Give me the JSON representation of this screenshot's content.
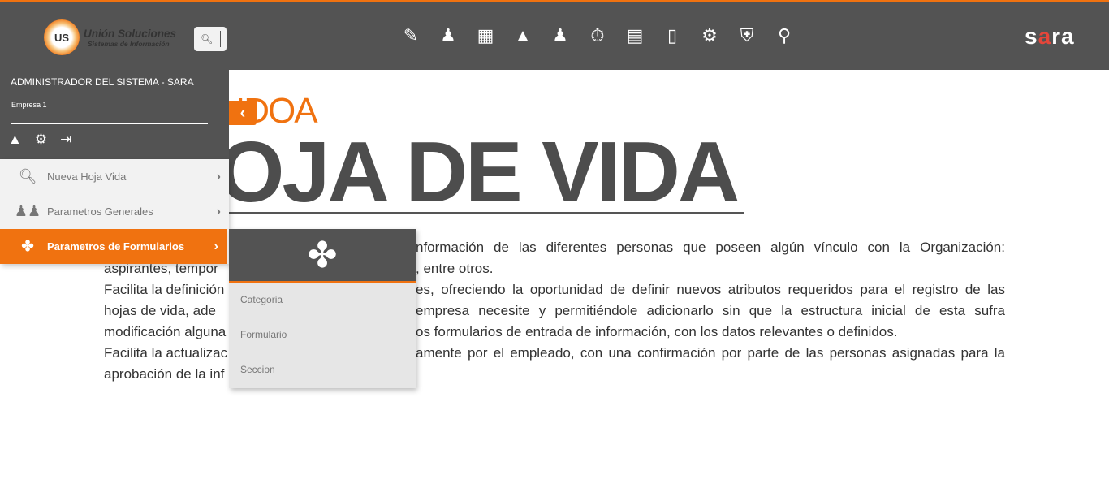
{
  "header": {
    "logo_title": "Unión Soluciones",
    "logo_subtitle": "Sistemas de Información",
    "logo_badge": "US",
    "search_icon": "search-icon",
    "nav_icons": [
      "form-edit-icon",
      "employee-icon",
      "gift-icon",
      "hierarchy-icon",
      "presentation-person-icon",
      "stopwatch-icon",
      "resume-icon",
      "training-board-icon",
      "gears-icon",
      "briefcase-shield-icon",
      "user-search-icon"
    ],
    "brand": "sara"
  },
  "profile": {
    "name": "ADMINISTRADOR DEL SISTEMA - SARA",
    "company": "Empresa 1"
  },
  "menu": {
    "items": [
      {
        "label": "Nueva Hoja Vida",
        "icon": "search-icon"
      },
      {
        "label": "Parametros Generales",
        "icon": "users-icon"
      },
      {
        "label": "Parametros de Formularios",
        "icon": "person-icon"
      }
    ]
  },
  "submenu": {
    "items": [
      "Categoria",
      "Formulario",
      "Seccion"
    ]
  },
  "main": {
    "kicker": "IDOA",
    "title": "OJA DE VIDA",
    "lines": [
      {
        "left": "",
        "right": "nformación de las diferentes personas que poseen algún vínculo con la Organización:"
      },
      {
        "left": "aspirantes, tempor",
        "right": ", entre otros."
      },
      {
        "left": "Facilita la definición",
        "right": "es, ofreciendo la oportunidad de definir nuevos atributos requeridos para el registro de las"
      },
      {
        "left": "hojas de vida, ade",
        "right": "empresa necesite y permitiéndole adicionarlo sin que la estructura inicial de esta sufra"
      },
      {
        "left": "modificación alguna",
        "right": "os formularios de entrada de información, con los datos relevantes o definidos."
      },
      {
        "left": "Facilita la actualizac",
        "right": "amente por el empleado, con una confirmación por parte de las personas asignadas para la"
      },
      {
        "left": "aprobación de la inf",
        "right": ""
      }
    ]
  },
  "colors": {
    "accent": "#f07210",
    "bar": "#535353"
  }
}
